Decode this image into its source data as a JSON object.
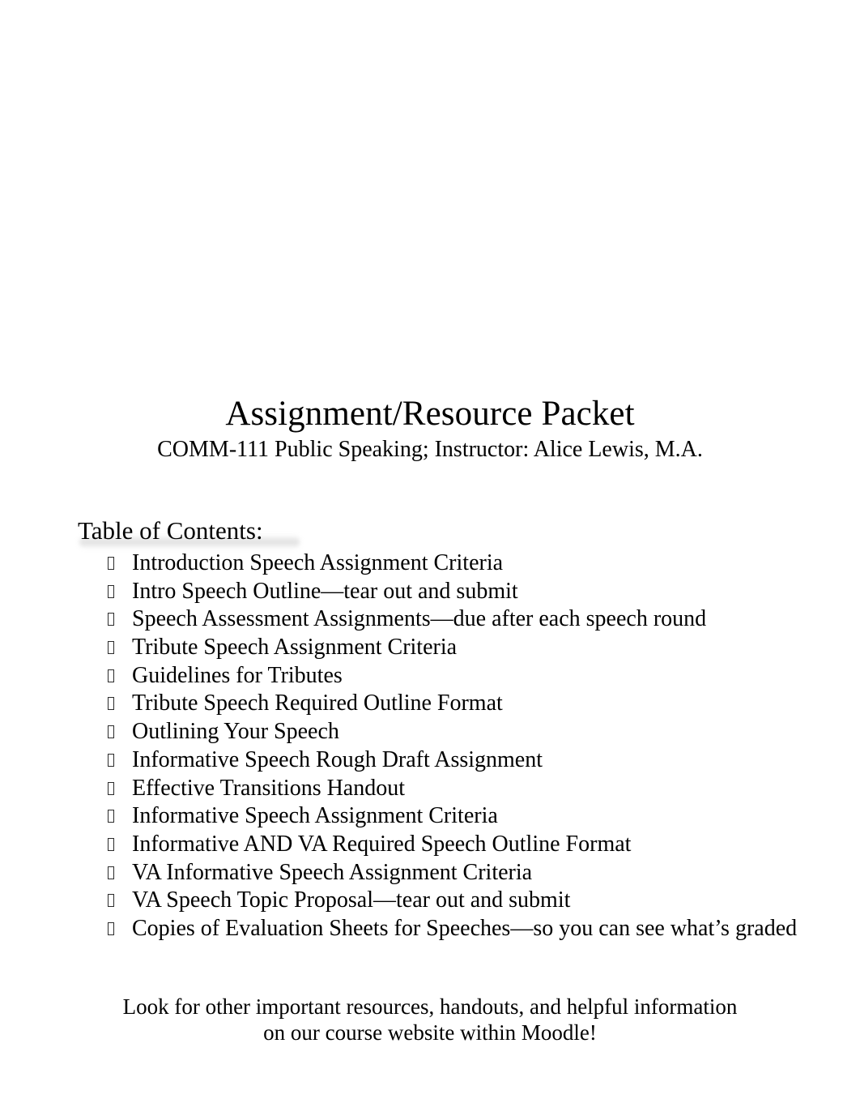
{
  "document": {
    "title": "Assignment/Resource Packet",
    "subtitle": "COMM-111 Public Speaking; Instructor: Alice Lewis, M.A."
  },
  "toc": {
    "heading": "Table of Contents:",
    "bullet_glyph": "missing-glyph-box",
    "items": [
      {
        "label": "Introduction Speech Assignment Criteria"
      },
      {
        "label": "Intro Speech Outline—tear out and submit"
      },
      {
        "label": "Speech Assessment Assignments—due after each speech round"
      },
      {
        "label": "Tribute Speech Assignment Criteria"
      },
      {
        "label": "Guidelines for Tributes"
      },
      {
        "label": "Tribute Speech Required Outline Format"
      },
      {
        "label": "Outlining Your Speech"
      },
      {
        "label": "Informative Speech Rough Draft Assignment"
      },
      {
        "label": "Effective Transitions Handout"
      },
      {
        "label": "Informative Speech Assignment Criteria"
      },
      {
        "label": "Informative AND VA Required Speech Outline Format"
      },
      {
        "label": "VA Informative Speech Assignment Criteria"
      },
      {
        "label": "VA Speech Topic Proposal—tear out and submit"
      },
      {
        "label": "Copies of Evaluation Sheets for Speeches—so you can see what’s graded"
      }
    ]
  },
  "footer": {
    "line1": "Look for other important resources, handouts, and helpful information",
    "line2": "on our course website within Moodle!"
  },
  "colors": {
    "page_background": "#ffffff",
    "text": "#000000",
    "smudge_gray": "#949494"
  }
}
